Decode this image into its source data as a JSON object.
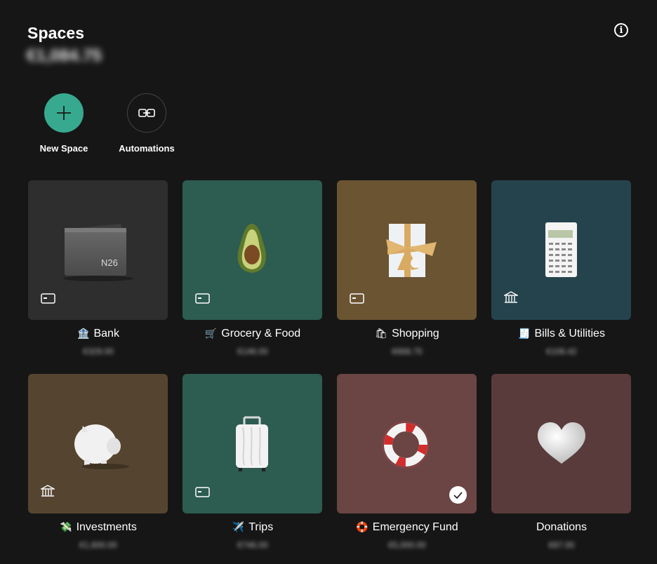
{
  "header": {
    "title": "Spaces",
    "total_balance": "€1,084.75"
  },
  "actions": [
    {
      "label": "New Space",
      "icon": "plus-icon"
    },
    {
      "label": "Automations",
      "icon": "link-icon"
    }
  ],
  "spaces": [
    {
      "name": "Bank",
      "emoji": "🏦",
      "amount": "€329.00",
      "color": "#2e2e2e",
      "badge": "card-icon",
      "image": "wallet-image"
    },
    {
      "name": "Grocery & Food",
      "emoji": "🛒",
      "amount": "€146.00",
      "color": "#2d5c51",
      "badge": "card-icon",
      "image": "avocado-image"
    },
    {
      "name": "Shopping",
      "emoji": "🛍",
      "amount": "€668.75",
      "color": "#6b5432",
      "badge": "card-icon",
      "image": "gift-image"
    },
    {
      "name": "Bills & Utilities",
      "emoji": "🧾",
      "amount": "€106.42",
      "color": "#25434d",
      "badge": "bank-icon",
      "image": "calculator-image"
    },
    {
      "name": "Investments",
      "emoji": "💸",
      "amount": "€1,600.00",
      "color": "#554530",
      "badge": "bank-icon",
      "image": "piggy-bank-image"
    },
    {
      "name": "Trips",
      "emoji": "✈️",
      "amount": "€746.00",
      "color": "#2d5c51",
      "badge": "card-icon",
      "image": "suitcase-image"
    },
    {
      "name": "Emergency Fund",
      "emoji": "🛟",
      "amount": "€5,000.00",
      "color": "#6b4444",
      "badge": "check-icon",
      "image": "lifebuoy-image"
    },
    {
      "name": "Donations",
      "emoji": "",
      "amount": "€87.00",
      "color": "#5a3b3b",
      "badge": "",
      "image": "heart-image"
    }
  ]
}
